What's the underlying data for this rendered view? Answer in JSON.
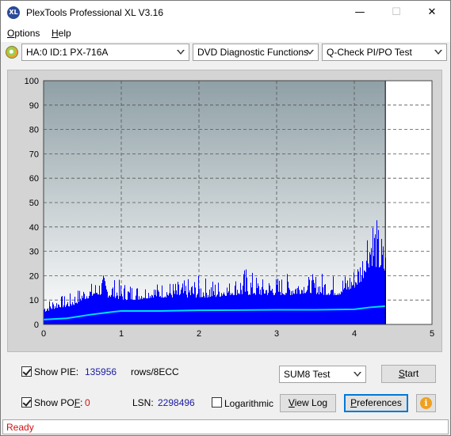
{
  "window": {
    "title": "PlexTools Professional XL V3.16",
    "app_icon_text": "XL",
    "minimize": "—",
    "maximize": "☐",
    "close": "✕"
  },
  "menu": {
    "options": {
      "first": "O",
      "rest": "ptions"
    },
    "help": {
      "first": "H",
      "rest": "elp"
    }
  },
  "toolbar": {
    "drive": "HA:0 ID:1  PX-716A",
    "function": "DVD Diagnostic Functions",
    "test": "Q-Check PI/PO Test"
  },
  "chart_data": {
    "type": "bar",
    "title": "",
    "xlabel": "",
    "ylabel": "",
    "xlim": [
      0,
      5
    ],
    "ylim": [
      0,
      100
    ],
    "x_ticks": [
      "0",
      "1",
      "2",
      "3",
      "4",
      "5"
    ],
    "y_ticks": [
      "0",
      "10",
      "20",
      "30",
      "40",
      "50",
      "60",
      "70",
      "80",
      "90",
      "100"
    ],
    "grid": true,
    "data_end_x": 4.4,
    "colors": {
      "pie": "#0000ff",
      "average": "#00e0ff",
      "plot_bg_top": "#8fa0a6",
      "plot_bg_bottom": "#ffffff",
      "end_region": "#ffffff"
    },
    "series": [
      {
        "name": "PIE",
        "x": [
          0.0,
          0.1,
          0.2,
          0.3,
          0.4,
          0.5,
          0.6,
          0.7,
          0.75,
          0.8,
          0.9,
          1.0,
          1.2,
          1.4,
          1.6,
          1.8,
          2.0,
          2.2,
          2.4,
          2.6,
          2.8,
          3.0,
          3.2,
          3.4,
          3.6,
          3.8,
          4.0,
          4.1,
          4.15,
          4.2,
          4.25,
          4.3,
          4.35,
          4.4
        ],
        "peak": [
          10,
          11,
          12,
          12,
          14,
          16,
          17,
          19,
          21,
          20,
          19,
          18,
          17,
          17,
          18,
          18,
          20,
          19,
          18,
          24,
          19,
          20,
          21,
          20,
          22,
          20,
          24,
          32,
          45,
          52,
          50,
          42,
          38,
          32
        ],
        "base": [
          5,
          6,
          7,
          7,
          8,
          10,
          11,
          12,
          12,
          11,
          11,
          10,
          10,
          11,
          11,
          11,
          11,
          11,
          12,
          12,
          12,
          12,
          12,
          13,
          12,
          12,
          15,
          18,
          22,
          24,
          24,
          23,
          22,
          20
        ]
      },
      {
        "name": "Average",
        "x": [
          0.0,
          0.3,
          0.6,
          0.9,
          1.0,
          1.5,
          2.0,
          2.5,
          3.0,
          3.5,
          4.0,
          4.2,
          4.4
        ],
        "values": [
          2,
          2.5,
          4,
          5.2,
          5.5,
          5.5,
          5.8,
          5.9,
          6.0,
          6.0,
          6.2,
          7.0,
          7.5
        ]
      }
    ]
  },
  "controls": {
    "show_pie_label": {
      "first": "Show PIE:",
      "rest": ""
    },
    "pie_value": "135956",
    "pie_unit": "rows/8ECC",
    "show_pof_label_a": "Show PO",
    "show_pof_label_u": "F",
    "show_pof_label_b": ":",
    "pof_value": "0",
    "lsn_label": "LSN:",
    "lsn_value": "2298496",
    "logarithmic_label": "Logarithmic",
    "test_mode": "SUM8 Test",
    "start_label_u": "S",
    "start_label_rest": "tart",
    "viewlog_label_a": "",
    "viewlog_label_u": "V",
    "viewlog_label_rest": "iew Log",
    "prefs_label_u": "P",
    "prefs_label_rest": "references",
    "info_icon_text": "i",
    "show_pie_checked": true,
    "show_pof_checked": true,
    "logarithmic_checked": false
  },
  "status": {
    "text": "Ready"
  }
}
